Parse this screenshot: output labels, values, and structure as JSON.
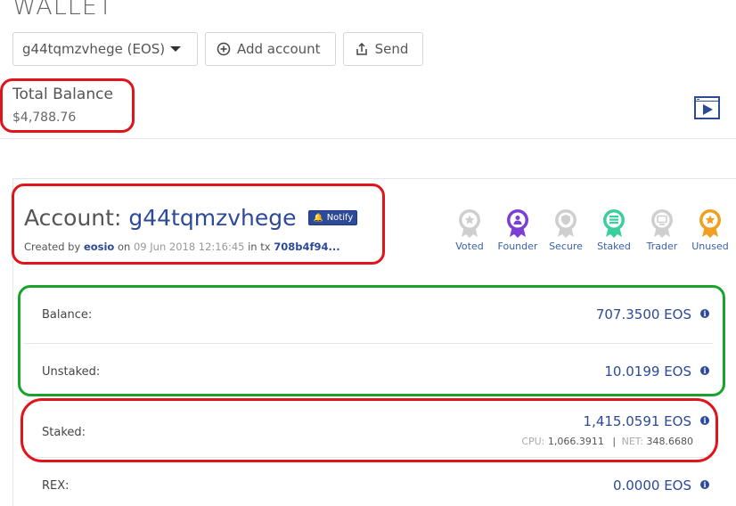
{
  "page": {
    "title": "WALLET"
  },
  "toolbar": {
    "account_select": "g44tqmzvhege (EOS)",
    "add_account_label": "Add account",
    "send_label": "Send"
  },
  "total": {
    "label": "Total Balance",
    "value": "$4,788.76"
  },
  "account": {
    "title_prefix": "Account:",
    "name": "g44tqmzvhege",
    "notify_label": "Notify",
    "created_prefix": "Created by",
    "creator": "eosio",
    "on_word": "on",
    "created_date": "09 Jun 2018 12:16:45",
    "tx_word": "in tx",
    "tx_hash": "708b4f94..."
  },
  "badges": [
    {
      "label": "Voted",
      "color": "#cfcfcf"
    },
    {
      "label": "Founder",
      "color": "#7b3fd6"
    },
    {
      "label": "Secure",
      "color": "#cfcfcf"
    },
    {
      "label": "Staked",
      "color": "#3ccf9c"
    },
    {
      "label": "Trader",
      "color": "#cfcfcf"
    },
    {
      "label": "Unused",
      "color": "#f0a020"
    }
  ],
  "rows": [
    {
      "label": "Balance:",
      "value": "707.3500 EOS"
    },
    {
      "label": "Unstaked:",
      "value": "10.0199 EOS"
    },
    {
      "label": "Staked:",
      "value": "1,415.0591 EOS",
      "cpu_label": "CPU:",
      "cpu_value": "1,066.3911",
      "sep": "|",
      "net_label": "NET:",
      "net_value": "348.6680"
    },
    {
      "label": "REX:",
      "value": "0.0000 EOS"
    }
  ],
  "colors": {
    "accent": "#2d4a99",
    "highlight_red": "#e0141b",
    "highlight_green": "#1aa32c"
  },
  "icons": {
    "add_account": "plus-circle-icon",
    "send": "send-icon",
    "video": "video-play-icon",
    "notify": "bell-icon",
    "info": "info-icon"
  }
}
